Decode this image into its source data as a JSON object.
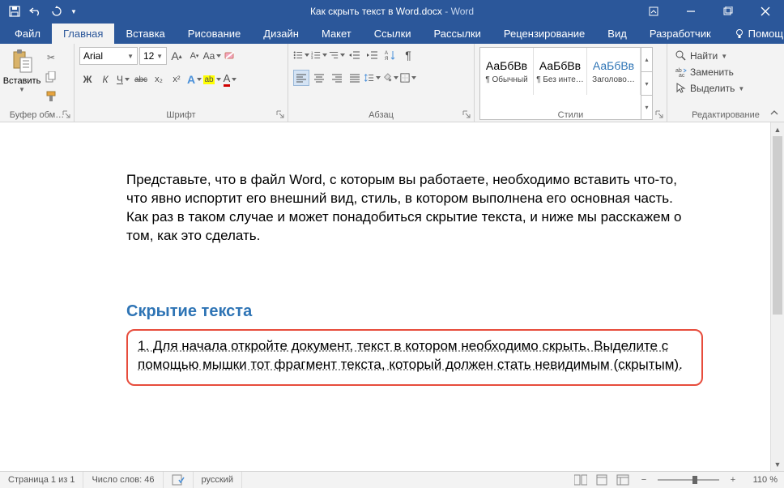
{
  "titlebar": {
    "doc_title": "Как скрыть текст в Word.docx",
    "app_name": "Word"
  },
  "tabs": {
    "file": "Файл",
    "home": "Главная",
    "insert": "Вставка",
    "draw": "Рисование",
    "design": "Дизайн",
    "layout": "Макет",
    "references": "Ссылки",
    "mailings": "Рассылки",
    "review": "Рецензирование",
    "view": "Вид",
    "developer": "Разработчик",
    "help": "Помощн"
  },
  "ribbon": {
    "clipboard": {
      "paste": "Вставить",
      "label": "Буфер обм…"
    },
    "font": {
      "name": "Arial",
      "size": "12",
      "bold": "Ж",
      "italic": "К",
      "underline": "Ч",
      "strike": "abc",
      "sub": "x₂",
      "sup": "x²",
      "case_btn": "Aa",
      "a_inc": "A",
      "a_dec": "A",
      "text_effects": "A",
      "highlight_icon": "ab",
      "font_color": "A",
      "label": "Шрифт"
    },
    "paragraph": {
      "label": "Абзац"
    },
    "styles": {
      "preview": "АаБбВв",
      "normal": "¶ Обычный",
      "no_spacing": "¶ Без инте…",
      "heading1": "Заголово…",
      "label": "Стили"
    },
    "editing": {
      "find": "Найти",
      "replace": "Заменить",
      "select": "Выделить",
      "label": "Редактирование"
    }
  },
  "document": {
    "para1": "Представьте, что в файл Word, с которым вы работаете, необходимо вставить что-то, что явно испортит его внешний вид, стиль, в котором выполнена его основная часть. Как раз в таком случае и может понадобиться скрытие текста, и ниже мы расскажем о том, как это сделать.",
    "heading": "Скрытие текста",
    "sel_text": "1. Для начала откройте документ, текст в котором необходимо скрыть. Выделите с помощью мышки тот фрагмент текста, который должен стать невидимым (скрытым)."
  },
  "statusbar": {
    "page": "Страница 1 из 1",
    "words": "Число слов: 46",
    "lang": "русский",
    "zoom": "110 %"
  }
}
